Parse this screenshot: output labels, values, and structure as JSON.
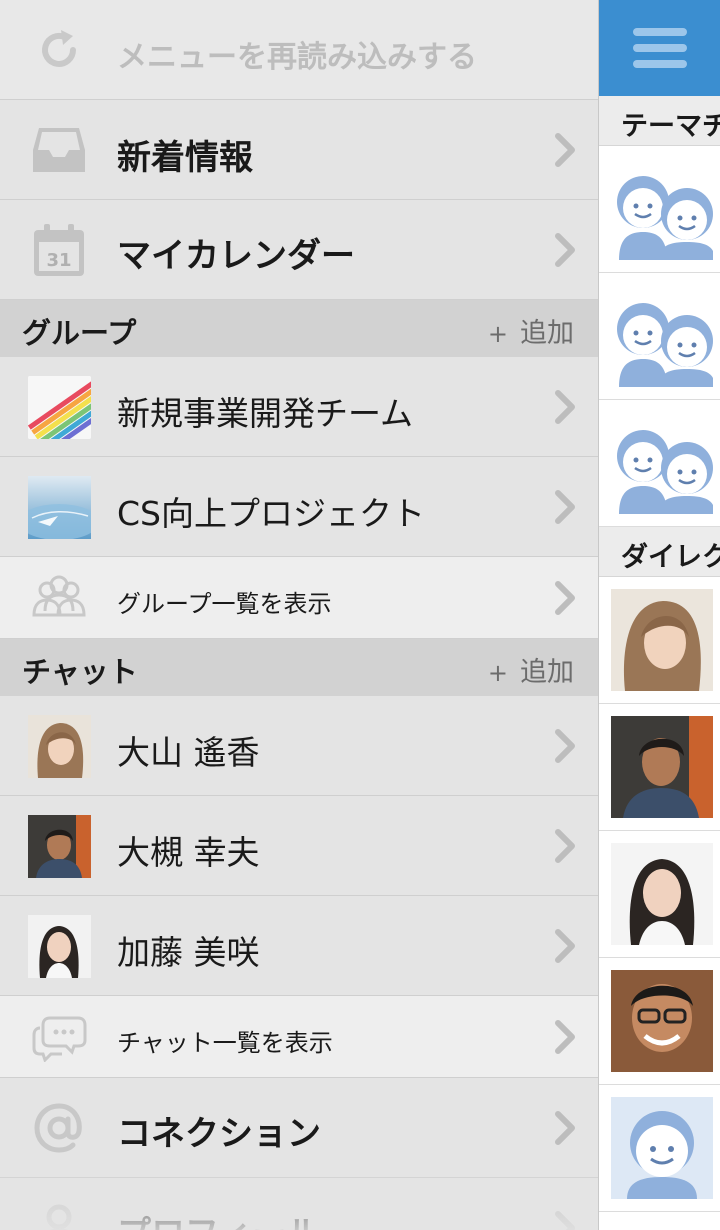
{
  "menu": {
    "reload_label": "メニューを再読み込みする",
    "news_label": "新着情報",
    "calendar_label": "マイカレンダー",
    "calendar_day": "31",
    "groups": {
      "title": "グループ",
      "add_label": "追加",
      "items": [
        {
          "label": "新規事業開発チーム"
        },
        {
          "label": "CS向上プロジェクト"
        }
      ],
      "view_all": "グループ一覧を表示"
    },
    "chat": {
      "title": "チャット",
      "add_label": "追加",
      "items": [
        {
          "label": "大山 遙香"
        },
        {
          "label": "大槻 幸夫"
        },
        {
          "label": "加藤 美咲"
        }
      ],
      "view_all": "チャット一覧を表示"
    },
    "connection_label": "コネクション",
    "profile_label": "プロフィール"
  },
  "content": {
    "section1_title": "テーマチャット",
    "section2_title": "ダイレクトチャット"
  },
  "colors": {
    "accent": "#3b8ed0",
    "avatar_blue": "#8fb0dc"
  }
}
